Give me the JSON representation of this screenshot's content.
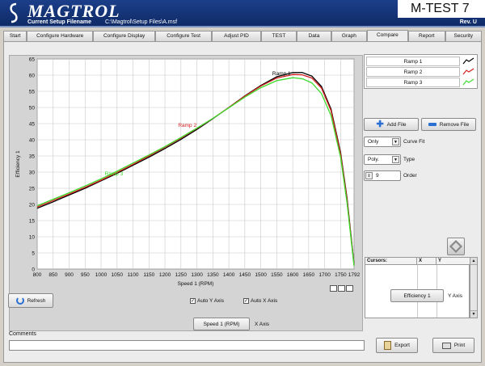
{
  "banner": {
    "brand": "MAGTROL",
    "filename_label": "Current Setup Filename",
    "filename_value": "C:\\Magtrol\\Setup Files\\A.msf",
    "product": "M-TEST 7",
    "revision": "Rev. U"
  },
  "tabs": [
    {
      "label": "Start",
      "active": false
    },
    {
      "label": "Configure Hardware",
      "active": false
    },
    {
      "label": "Configure Display",
      "active": false
    },
    {
      "label": "Configure Test",
      "active": false
    },
    {
      "label": "Adjust PID",
      "active": false
    },
    {
      "label": "TEST",
      "active": false
    },
    {
      "label": "Data",
      "active": false
    },
    {
      "label": "Graph",
      "active": false
    },
    {
      "label": "Compare",
      "active": true
    },
    {
      "label": "Report",
      "active": false
    },
    {
      "label": "Security",
      "active": false
    }
  ],
  "legend": [
    {
      "label": "Ramp 1",
      "color": "#000000"
    },
    {
      "label": "Ramp 2",
      "color": "#d62020"
    },
    {
      "label": "Ramp 3",
      "color": "#3cdc2c"
    }
  ],
  "controls": {
    "add_file": "Add File",
    "remove_file": "Remove File",
    "fit_mode": "Only",
    "curve_fit_label": "Curve Fit",
    "fit_type": "Poly.",
    "type_label": "Type",
    "order_value": "9",
    "order_label": "Order",
    "refresh": "Refresh",
    "auto_y": "Auto Y Axis",
    "auto_x": "Auto X Axis",
    "x_axis_select": "Speed 1 (RPM)",
    "x_axis_label": "X Axis",
    "y_axis_select": "Efficiency 1",
    "y_axis_label": "Y Axis",
    "export": "Export",
    "print": "Print",
    "comments_label": "Comments"
  },
  "cursor_table": {
    "headers": [
      "Cursors:",
      "X",
      "Y"
    ]
  },
  "chart_data": {
    "type": "line",
    "xlabel": "Speed 1 (RPM)",
    "ylabel": "Efficiency 1",
    "xlim": [
      800,
      1792
    ],
    "ylim": [
      0,
      65
    ],
    "xticks": [
      800,
      850,
      900,
      950,
      1000,
      1050,
      1100,
      1150,
      1200,
      1250,
      1300,
      1350,
      1400,
      1450,
      1500,
      1550,
      1600,
      1650,
      1700,
      1750,
      1792
    ],
    "yticks": [
      0,
      5,
      10,
      15,
      20,
      25,
      30,
      35,
      40,
      45,
      50,
      55,
      60,
      65
    ],
    "grid": true,
    "series": [
      {
        "name": "Ramp 1",
        "color": "#000000",
        "x": [
          800,
          850,
          900,
          950,
          1000,
          1050,
          1100,
          1150,
          1200,
          1250,
          1300,
          1350,
          1400,
          1450,
          1500,
          1550,
          1600,
          1630,
          1660,
          1690,
          1720,
          1750,
          1770,
          1792
        ],
        "y": [
          18.8,
          20.8,
          22.9,
          25.0,
          27.3,
          29.6,
          32.1,
          34.6,
          37.3,
          40.1,
          43.2,
          46.5,
          50.0,
          53.6,
          56.8,
          59.5,
          60.8,
          60.8,
          59.7,
          56.5,
          49.5,
          36.0,
          22.0,
          1.5
        ]
      },
      {
        "name": "Ramp 2",
        "color": "#d62020",
        "x": [
          800,
          850,
          900,
          950,
          1000,
          1050,
          1100,
          1150,
          1200,
          1250,
          1300,
          1350,
          1400,
          1450,
          1500,
          1550,
          1600,
          1630,
          1660,
          1690,
          1720,
          1750,
          1770,
          1792
        ],
        "y": [
          19.2,
          21.2,
          23.2,
          25.3,
          27.5,
          29.9,
          32.4,
          35.0,
          37.7,
          40.5,
          43.5,
          46.6,
          50.0,
          53.5,
          56.6,
          59.1,
          60.2,
          60.1,
          59.1,
          56.0,
          49.0,
          35.5,
          21.5,
          1.2
        ]
      },
      {
        "name": "Ramp 3",
        "color": "#3cdc2c",
        "x": [
          800,
          850,
          900,
          950,
          1000,
          1050,
          1100,
          1150,
          1200,
          1250,
          1300,
          1350,
          1400,
          1450,
          1500,
          1550,
          1600,
          1630,
          1660,
          1690,
          1720,
          1750,
          1770,
          1792
        ],
        "y": [
          19.6,
          21.6,
          23.6,
          25.7,
          27.9,
          30.3,
          32.8,
          35.3,
          37.9,
          40.7,
          43.6,
          46.6,
          49.9,
          53.2,
          56.1,
          58.3,
          59.2,
          58.9,
          57.6,
          54.3,
          47.5,
          34.5,
          20.5,
          1.0
        ]
      }
    ],
    "annotations": [
      {
        "text": "Ramp 1",
        "x": 1565,
        "y": 60,
        "color": "#000000"
      },
      {
        "text": "Ramp 2",
        "x": 1270,
        "y": 44,
        "color": "#d62020"
      },
      {
        "text": "Ramp 3",
        "x": 1040,
        "y": 29,
        "color": "#3cdc2c"
      }
    ]
  }
}
